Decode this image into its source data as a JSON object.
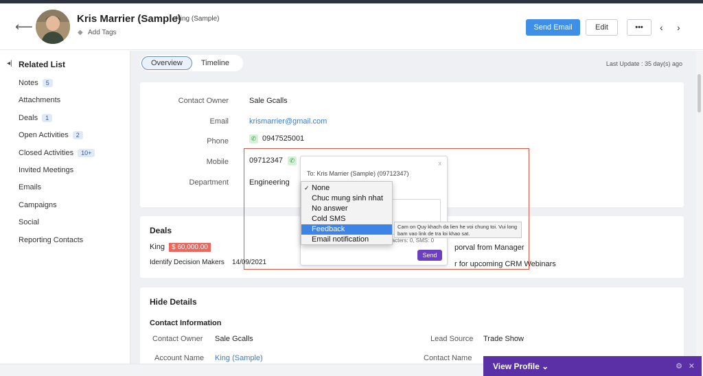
{
  "header": {
    "name": "Kris Marrier (Sample)",
    "role": "- King (Sample)",
    "add_tags": "Add Tags",
    "send_email": "Send Email",
    "edit": "Edit",
    "more": "•••"
  },
  "sidebar": {
    "title": "Related List",
    "items": [
      {
        "label": "Notes",
        "badge": "5"
      },
      {
        "label": "Attachments",
        "badge": ""
      },
      {
        "label": "Deals",
        "badge": "1"
      },
      {
        "label": "Open Activities",
        "badge": "2"
      },
      {
        "label": "Closed Activities",
        "badge": "10+"
      },
      {
        "label": "Invited Meetings",
        "badge": ""
      },
      {
        "label": "Emails",
        "badge": ""
      },
      {
        "label": "Campaigns",
        "badge": ""
      },
      {
        "label": "Social",
        "badge": ""
      },
      {
        "label": "Reporting Contacts",
        "badge": ""
      }
    ]
  },
  "tabs": {
    "overview": "Overview",
    "timeline": "Timeline"
  },
  "last_update": "Last Update : 35 day(s) ago",
  "details": {
    "contact_owner_label": "Contact Owner",
    "contact_owner": "Sale Gcalls",
    "email_label": "Email",
    "email": "krismarrier@gmail.com",
    "phone_label": "Phone",
    "phone": "0947525001",
    "mobile_label": "Mobile",
    "mobile": "09712347",
    "department_label": "Department",
    "department": "Engineering"
  },
  "deals": {
    "title": "Deals",
    "name": "King",
    "amount": "$ 60,000.00",
    "stage": "Identify Decision Makers",
    "date": "14/09/2021",
    "task1": "porval from Manager",
    "task2": "r for upcoming CRM Webinars"
  },
  "hide_details": {
    "title": "Hide Details",
    "section": "Contact Information",
    "contact_owner_label": "Contact Owner",
    "contact_owner": "Sale Gcalls",
    "lead_source_label": "Lead Source",
    "lead_source": "Trade Show",
    "account_name_label": "Account Name",
    "account_name": "King (Sample)",
    "contact_name_label": "Contact Name"
  },
  "sms": {
    "to": "To: Kris Marrier (Sample) (09712347)",
    "close": "x",
    "count": "racters: 0, SMS: 0",
    "send": "Send"
  },
  "dropdown": {
    "options": [
      "None",
      "Chuc mung sinh nhat",
      "No answer",
      "Cold SMS",
      "Feedback",
      "Email notification"
    ],
    "selected": "None",
    "hovered": "Feedback"
  },
  "tooltip": "Cam on Quy khach da lien he voi chung toi. Vui long bam vao link de tra loi khao sat.",
  "view_profile": {
    "label": "View Profile ⌄"
  },
  "colors": {
    "primary": "#3d8fe8",
    "highlight": "#e0523f",
    "purple": "#5b2fa6",
    "amount": "#f0655b"
  }
}
